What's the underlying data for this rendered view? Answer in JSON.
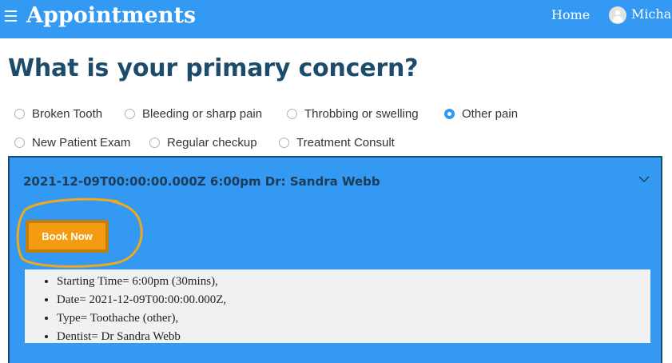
{
  "header": {
    "title": "Appointments",
    "nav_home": "Home",
    "user_name": "Michael"
  },
  "main": {
    "heading": "What is your primary concern?",
    "options": [
      {
        "label": "Broken Tooth",
        "checked": false
      },
      {
        "label": "Bleeding or sharp pain",
        "checked": false
      },
      {
        "label": "Throbbing or swelling",
        "checked": false
      },
      {
        "label": "Other pain",
        "checked": true
      },
      {
        "label": "New Patient Exam",
        "checked": false
      },
      {
        "label": "Regular checkup",
        "checked": false
      },
      {
        "label": "Treatment Consult",
        "checked": false
      }
    ],
    "appointment": {
      "header": "2021-12-09T00:00:00.000Z 6:00pm Dr: Sandra Webb",
      "book_label": "Book Now",
      "details": [
        "Starting Time= 6:00pm (30mins),",
        "Date= 2021-12-09T00:00:00.000Z,",
        "Type= Toothache (other),",
        "Dentist= Dr Sandra Webb"
      ]
    }
  },
  "colors": {
    "brand_blue": "#3399f3",
    "heading_navy": "#1d4b6b",
    "accent_orange": "#f39c12",
    "annotation_orange": "#f0a81c"
  }
}
